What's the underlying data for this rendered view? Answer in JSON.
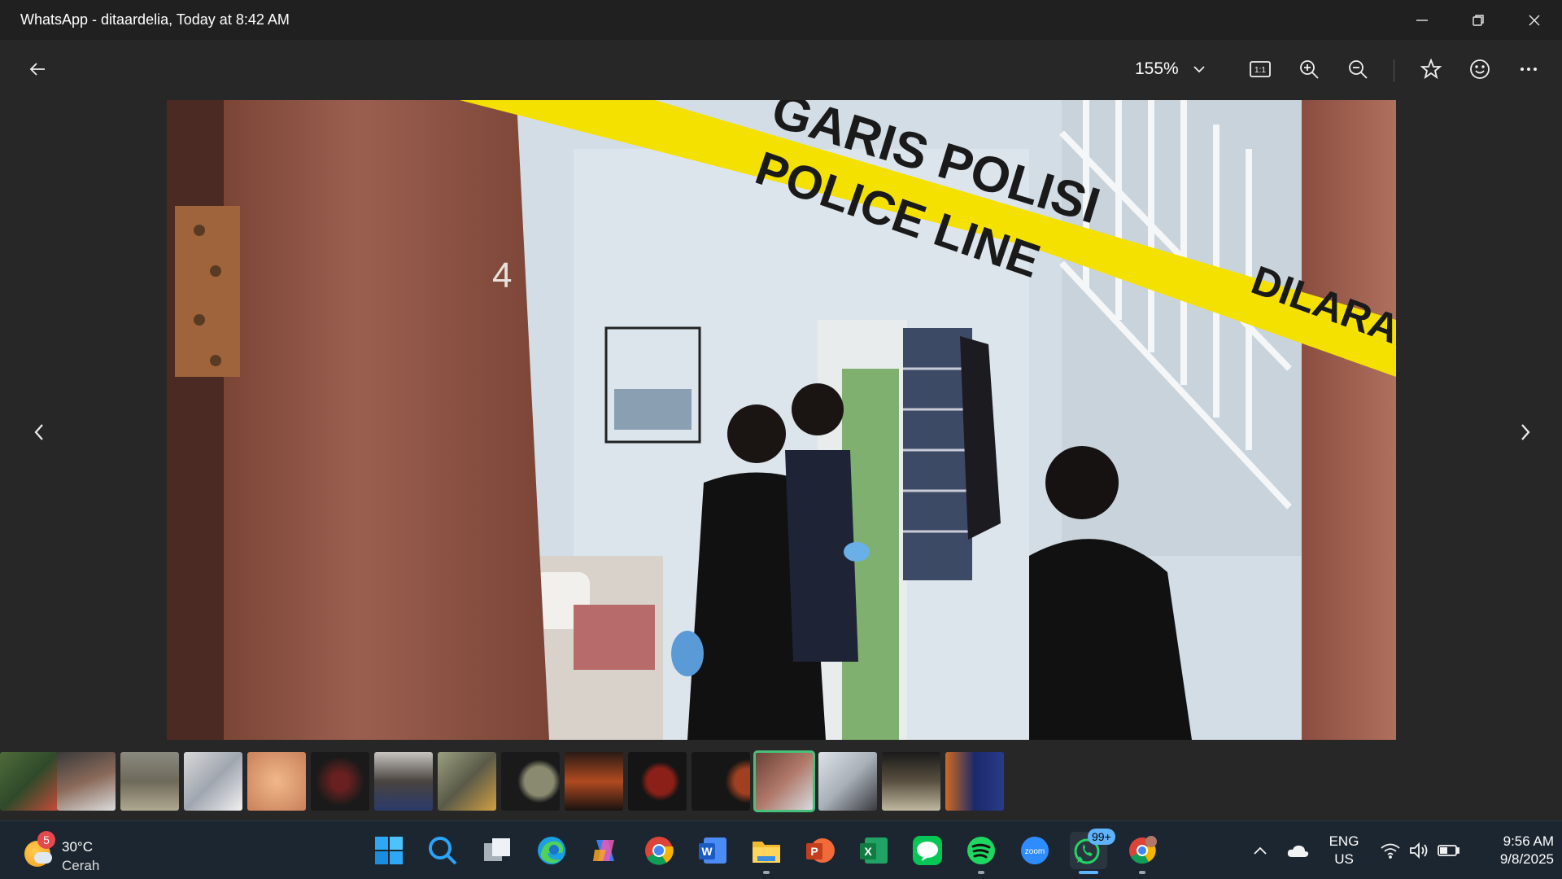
{
  "window": {
    "title": "WhatsApp - ditaardelia, Today at 8:42 AM"
  },
  "toolbar": {
    "zoom_level": "155%",
    "actual_size_label": "1:1"
  },
  "photo": {
    "tape_text_line1": "GARIS POLISI",
    "tape_text_line2": "POLICE LINE",
    "tape_text_right": "DILARANG",
    "door_number": "4"
  },
  "filmstrip": {
    "active_index": 12,
    "count": 16
  },
  "taskbar": {
    "weather_badge": "5",
    "weather_temp": "30°C",
    "weather_condition": "Cerah",
    "whatsapp_badge": "99+",
    "lang_line1": "ENG",
    "lang_line2": "US",
    "time": "9:56 AM",
    "date": "9/8/2025",
    "word_letter": "W",
    "ppt_letter": "P",
    "excel_letter": "X",
    "zoom_label": "zoom"
  },
  "colors": {
    "tape_yellow": "#f5e100",
    "active_thumb": "#49c07a",
    "taskbar_bg": "#1c2630"
  }
}
